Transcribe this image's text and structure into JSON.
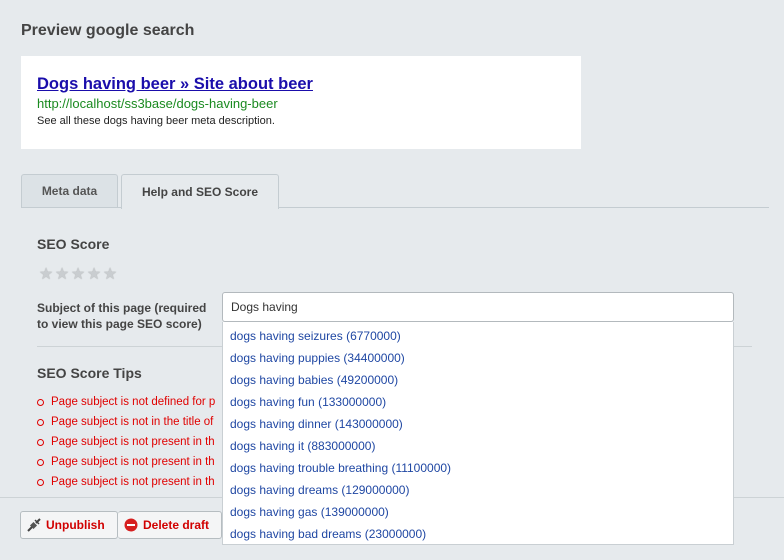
{
  "heading": "Preview google search",
  "preview": {
    "title": "Dogs having beer » Site about beer",
    "url": "http://localhost/ss3base/dogs-having-beer",
    "description": "See all these dogs having beer meta description."
  },
  "tabs": [
    {
      "label": "Meta data",
      "active": false
    },
    {
      "label": "Help and SEO Score",
      "active": true
    }
  ],
  "seo_score": {
    "title": "SEO Score",
    "stars_total": 5,
    "stars_filled": 0
  },
  "subject": {
    "label": "Subject of this page (required to view this page SEO score)",
    "value": "Dogs having"
  },
  "suggestions": [
    "dogs having seizures (6770000)",
    "dogs having puppies (34400000)",
    "dogs having babies (49200000)",
    "dogs having fun (133000000)",
    "dogs having dinner (143000000)",
    "dogs having it (883000000)",
    "dogs having trouble breathing (11100000)",
    "dogs having dreams (129000000)",
    "dogs having gas (139000000)",
    "dogs having bad dreams (23000000)"
  ],
  "tips": {
    "title": "SEO Score Tips",
    "items": [
      "Page subject is not defined for p",
      "Page subject is not in the title of",
      "Page subject is not present in th",
      "Page subject is not present in th",
      "Page subject is not present in th"
    ]
  },
  "footer": {
    "unpublish_label": "Unpublish",
    "delete_label": "Delete draft"
  },
  "colors": {
    "link": "#1a0dab",
    "url": "#1a8a20",
    "suggestion": "#1f47a3",
    "error": "#e00000"
  }
}
